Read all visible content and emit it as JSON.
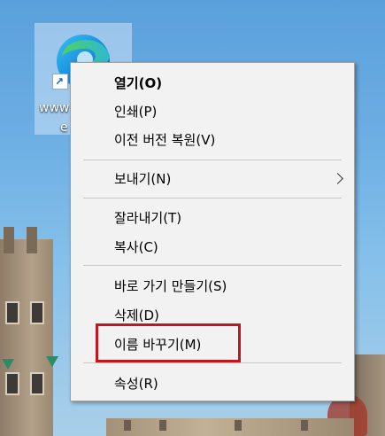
{
  "desktop_icon": {
    "label": "www",
    "label_tail": "e",
    "icon": "edge-icon",
    "shortcut_icon": "shortcut-arrow-icon"
  },
  "context_menu": {
    "items": [
      {
        "label": "열기(O)",
        "bold": true
      },
      {
        "label": "인쇄(P)"
      },
      {
        "label": "이전 버전 복원(V)"
      },
      {
        "label": "보내기(N)",
        "submenu": true
      },
      {
        "label": "잘라내기(T)"
      },
      {
        "label": "복사(C)"
      },
      {
        "label": "바로 가기 만들기(S)"
      },
      {
        "label": "삭제(D)"
      },
      {
        "label": "이름 바꾸기(M)",
        "highlighted": true
      },
      {
        "label": "속성(R)"
      }
    ]
  },
  "colors": {
    "highlight_border": "#c0171b",
    "menu_background": "#f2f2f2"
  }
}
